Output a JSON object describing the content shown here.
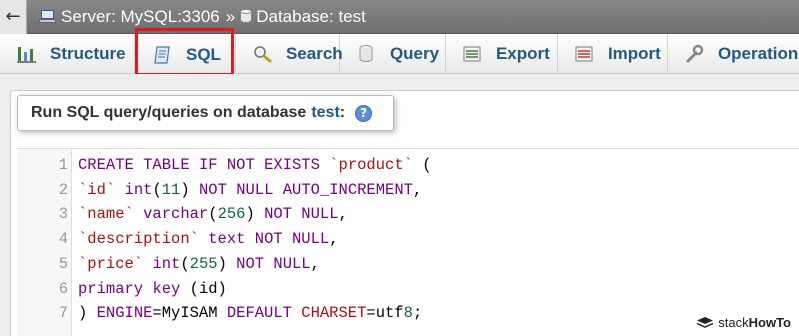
{
  "breadcrumb": {
    "back_glyph": "←",
    "server_label": "Server: MySQL:3306",
    "separator": "»",
    "database_label": "Database: test"
  },
  "tabs": [
    {
      "label": "Structure",
      "icon": "structure-icon"
    },
    {
      "label": "SQL",
      "icon": "sql-document-icon",
      "highlighted": true
    },
    {
      "label": "Search",
      "icon": "search-icon"
    },
    {
      "label": "Query",
      "icon": "query-icon"
    },
    {
      "label": "Export",
      "icon": "export-icon"
    },
    {
      "label": "Import",
      "icon": "import-icon"
    },
    {
      "label": "Operations",
      "icon": "wrench-icon"
    }
  ],
  "query_panel": {
    "legend_prefix": "Run SQL query/queries on database",
    "database_name": "test",
    "colon": ":",
    "help_glyph": "?"
  },
  "editor": {
    "line_numbers": [
      "1",
      "2",
      "3",
      "4",
      "5",
      "6",
      "7"
    ],
    "lines": [
      "CREATE TABLE IF NOT EXISTS `product` (",
      "`id` int(11) NOT NULL AUTO_INCREMENT,",
      "`name` varchar(256) NOT NULL,",
      "`description` text NOT NULL,",
      "`price` int(255) NOT NULL,",
      "primary key (id)",
      ") ENGINE=MyISAM DEFAULT CHARSET=utf8;"
    ]
  },
  "watermark": {
    "brand_light": "stack",
    "brand_bold": "HowTo"
  },
  "colors": {
    "highlight": "#e0191b",
    "tab_text": "#235a81",
    "keyword": "#770088",
    "string": "#aa1111",
    "number": "#116644"
  }
}
